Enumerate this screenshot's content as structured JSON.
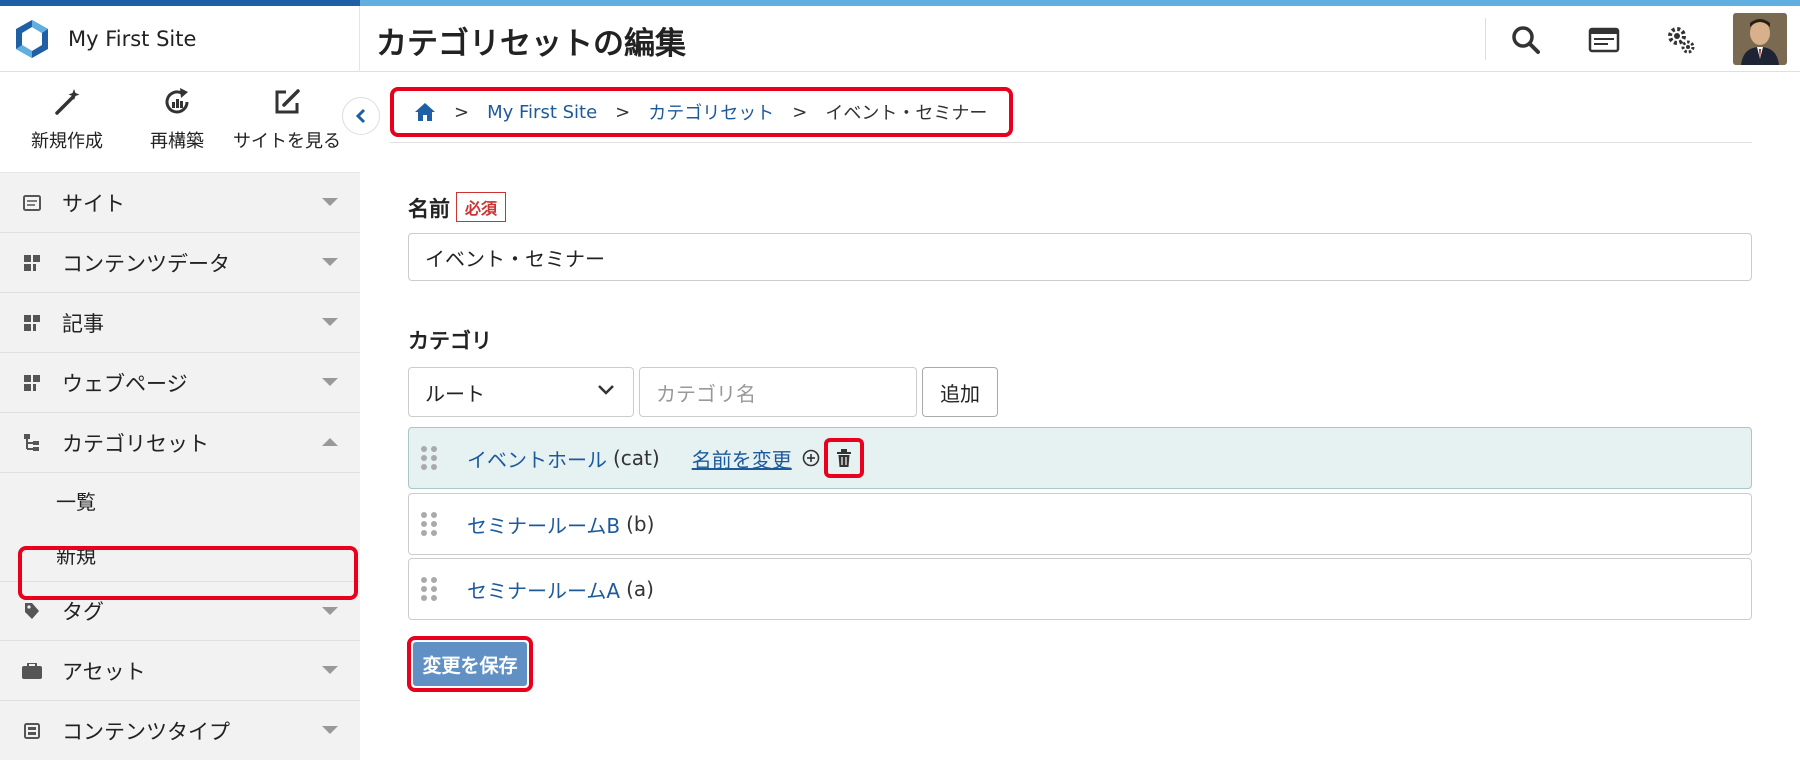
{
  "header": {
    "site_name": "My First Site",
    "page_title": "カテゴリセットの編集"
  },
  "sidebar": {
    "quick_actions": [
      {
        "label": "新規作成",
        "icon": "magic-wand-icon"
      },
      {
        "label": "再構築",
        "icon": "rebuild-icon"
      },
      {
        "label": "サイトを見る",
        "icon": "external-edit-icon"
      }
    ],
    "items": [
      {
        "label": "サイト",
        "icon": "site-icon"
      },
      {
        "label": "コンテンツデータ",
        "icon": "content-data-icon"
      },
      {
        "label": "記事",
        "icon": "entry-icon"
      },
      {
        "label": "ウェブページ",
        "icon": "webpage-icon"
      },
      {
        "label": "カテゴリセット",
        "icon": "category-set-icon",
        "expanded": true
      },
      {
        "label": "タグ",
        "icon": "tag-icon"
      },
      {
        "label": "アセット",
        "icon": "asset-icon"
      },
      {
        "label": "コンテンツタイプ",
        "icon": "content-type-icon"
      }
    ],
    "sub_items": [
      {
        "label": "一覧"
      },
      {
        "label": "新規"
      }
    ]
  },
  "breadcrumb": {
    "items": [
      "My First Site",
      "カテゴリセット",
      "イベント・セミナー"
    ],
    "separator": ">"
  },
  "form": {
    "name_label": "名前",
    "required_badge": "必須",
    "name_value": "イベント・セミナー",
    "category_label": "カテゴリ",
    "parent_select": "ルート",
    "category_placeholder": "カテゴリ名",
    "add_button": "追加",
    "categories": [
      {
        "name": "イベントホール",
        "slug": "(cat)"
      },
      {
        "name": "セミナールームB",
        "slug": "(b)"
      },
      {
        "name": "セミナールームA",
        "slug": "(a)"
      }
    ],
    "rename_link": "名前を変更",
    "save_button": "変更を保存"
  },
  "colors": {
    "accent_dark": "#1f5fa6",
    "accent_light": "#5fb0e0",
    "link": "#1d5a9c",
    "highlight": "#e8001c",
    "save_button": "#6090c4"
  }
}
